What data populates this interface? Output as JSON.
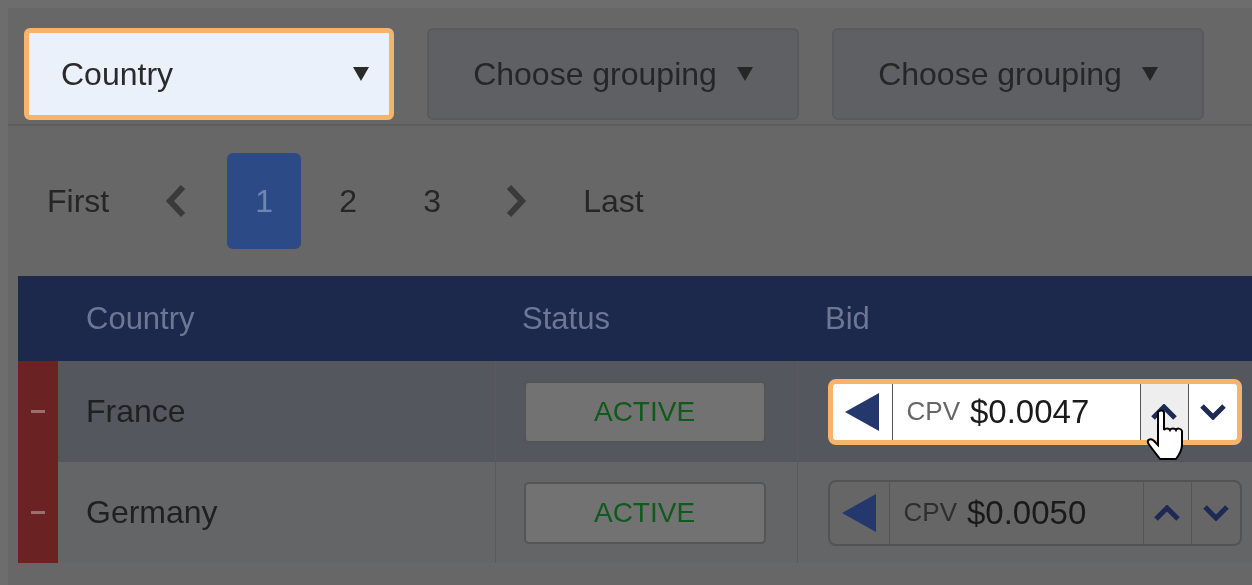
{
  "groupings": [
    {
      "label": "Country",
      "highlighted": true
    },
    {
      "label": "Choose grouping",
      "highlighted": false
    },
    {
      "label": "Choose grouping",
      "highlighted": false
    }
  ],
  "pagination": {
    "first": "First",
    "last": "Last",
    "pages": [
      {
        "label": "1",
        "selected": true
      },
      {
        "label": "2",
        "selected": false
      },
      {
        "label": "3",
        "selected": false
      }
    ]
  },
  "table": {
    "columns": [
      "Country",
      "Status",
      "Bid"
    ],
    "rows": [
      {
        "country": "France",
        "status": "ACTIVE",
        "bid_type": "CPV",
        "bid": "$0.0047",
        "highlighted": true
      },
      {
        "country": "Germany",
        "status": "ACTIVE",
        "bid_type": "CPV",
        "bid": "$0.0050",
        "highlighted": false
      }
    ]
  }
}
